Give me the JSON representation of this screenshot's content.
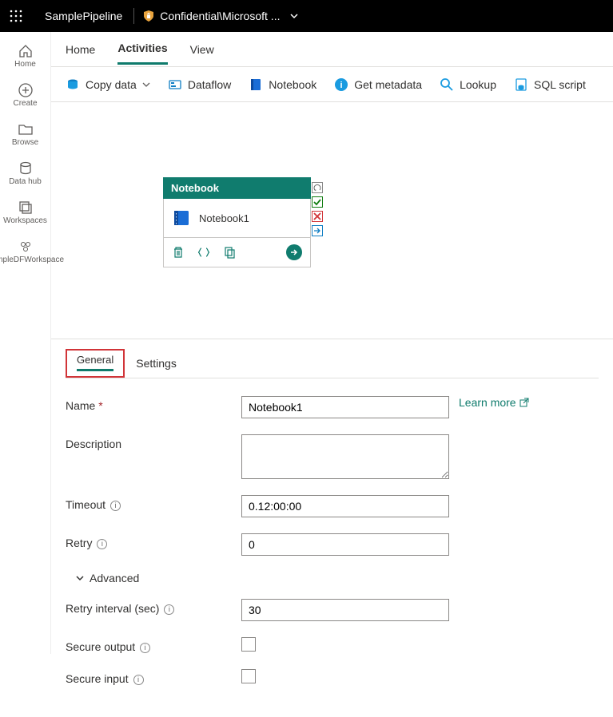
{
  "header": {
    "pipeline_name": "SamplePipeline",
    "confidential_label": "Confidential\\Microsoft ..."
  },
  "left_rail": {
    "items": [
      {
        "label": "Home"
      },
      {
        "label": "Create"
      },
      {
        "label": "Browse"
      },
      {
        "label": "Data hub"
      },
      {
        "label": "Workspaces"
      },
      {
        "label": "SampleDFWorkspace"
      }
    ]
  },
  "tabs": {
    "items": [
      {
        "label": "Home"
      },
      {
        "label": "Activities"
      },
      {
        "label": "View"
      }
    ],
    "active": 1
  },
  "toolbar": {
    "copy_data": "Copy data",
    "dataflow": "Dataflow",
    "notebook": "Notebook",
    "get_metadata": "Get metadata",
    "lookup": "Lookup",
    "sql_script": "SQL script"
  },
  "canvas": {
    "node": {
      "header": "Notebook",
      "label": "Notebook1"
    }
  },
  "panel": {
    "tabs": {
      "general": "General",
      "settings": "Settings"
    },
    "learn_more": "Learn more",
    "fields": {
      "name_label": "Name",
      "name_value": "Notebook1",
      "description_label": "Description",
      "description_value": "",
      "timeout_label": "Timeout",
      "timeout_value": "0.12:00:00",
      "retry_label": "Retry",
      "retry_value": "0",
      "advanced_label": "Advanced",
      "retry_interval_label": "Retry interval (sec)",
      "retry_interval_value": "30",
      "secure_output_label": "Secure output",
      "secure_input_label": "Secure input"
    }
  }
}
